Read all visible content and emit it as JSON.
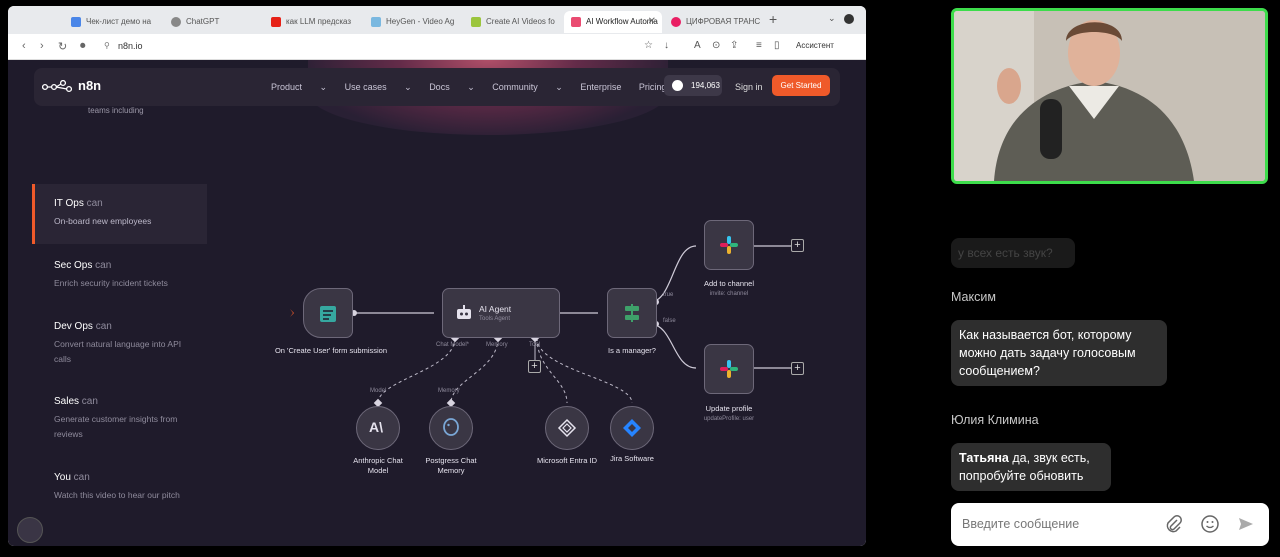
{
  "browser": {
    "tabs": [
      {
        "label": "Чек-лист демо на "
      },
      {
        "label": "ChatGPT"
      },
      {
        "label": "как LLM предсказ"
      },
      {
        "label": "HeyGen - Video Ag"
      },
      {
        "label": "Create AI Videos fo"
      },
      {
        "label": "AI Workflow Automa"
      },
      {
        "label": "ЦИФРОВАЯ ТРАНС"
      }
    ],
    "url": "n8n.io",
    "assistant_label": "Ассистент"
  },
  "site": {
    "logo": "n8n",
    "nav": [
      "Product",
      "Use cases",
      "Docs",
      "Community",
      "Enterprise",
      "Pricing"
    ],
    "github_stars": "194,063",
    "sign_in": "Sign in",
    "get_started": "Get Started",
    "teams_text": "teams including",
    "sidebar": [
      {
        "role": "IT Ops",
        "can": "can",
        "desc": "On-board new employees"
      },
      {
        "role": "Sec Ops",
        "can": "can",
        "desc": "Enrich security incident tickets"
      },
      {
        "role": "Dev Ops",
        "can": "can",
        "desc": "Convert natural language into API calls"
      },
      {
        "role": "Sales",
        "can": "can",
        "desc": "Generate customer insights from reviews"
      },
      {
        "role": "You",
        "can": "can",
        "desc": "Watch this video to hear our pitch"
      }
    ],
    "workflow": {
      "trigger": "On 'Create User' form submission",
      "agent_title": "AI Agent",
      "agent_sub": "Tools Agent",
      "agent_ports": [
        "Chat Model*",
        "Memory",
        "Tool"
      ],
      "switch": "Is a manager?",
      "true_label": "true",
      "false_label": "false",
      "slack1": "Add to channel",
      "slack1_sub": "invite: channel",
      "slack2": "Update profile",
      "slack2_sub": "updateProfile: user",
      "model_tag": "Model",
      "memory_tag": "Memory",
      "anthropic": "Anthropic Chat Model",
      "postgres": "Postgress Chat Memory",
      "entra": "Microsoft Entra ID",
      "jira": "Jira Software"
    }
  },
  "chat": {
    "faded_message": "у всех есть звук?",
    "messages": [
      {
        "author": "Максим",
        "text": "Как называется бот, которому можно дать задачу голосовым сообщением?"
      },
      {
        "author": "Юлия Климина",
        "mention": "Татьяна",
        "text": " да, звук есть, попробуйте обновить"
      }
    ],
    "input_placeholder": "Введите сообщение"
  },
  "colors": {
    "accent": "#ef5a2a",
    "video_border": "#3ddc4b",
    "page_bg": "#1f1b2b"
  }
}
